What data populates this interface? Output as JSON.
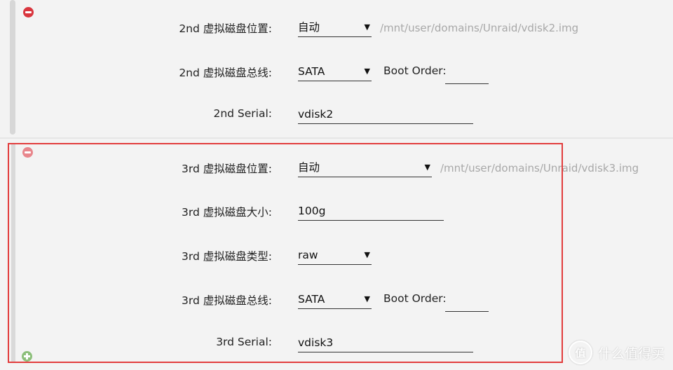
{
  "disk2": {
    "location_label": "2nd 虚拟磁盘位置:",
    "location_value": "自动",
    "location_path": "/mnt/user/domains/Unraid/vdisk2.img",
    "bus_label": "2nd 虚拟磁盘总线:",
    "bus_value": "SATA",
    "boot_order_label": "Boot Order:",
    "boot_order_value": "",
    "serial_label": "2nd Serial:",
    "serial_value": "vdisk2"
  },
  "disk3": {
    "location_label": "3rd 虚拟磁盘位置:",
    "location_value": "自动",
    "location_path": "/mnt/user/domains/Unraid/vdisk3.img",
    "size_label": "3rd 虚拟磁盘大小:",
    "size_value": "100g",
    "type_label": "3rd 虚拟磁盘类型:",
    "type_value": "raw",
    "bus_label": "3rd 虚拟磁盘总线:",
    "bus_value": "SATA",
    "boot_order_label": "Boot Order:",
    "boot_order_value": "",
    "serial_label": "3rd Serial:",
    "serial_value": "vdisk3"
  },
  "icons": {
    "remove": "minus-circle-icon",
    "add": "plus-circle-icon",
    "dropdown": "caret-down-icon"
  },
  "glyphs": {
    "caret": "▼"
  },
  "watermark": {
    "logo_text": "值",
    "text": "什么值得买"
  },
  "colors": {
    "remove_active": "#d9363e",
    "remove_faded": "#e8868c",
    "add": "#8cbf7a",
    "highlight_border": "#e23c3c",
    "path_text": "#a8a8a8"
  }
}
